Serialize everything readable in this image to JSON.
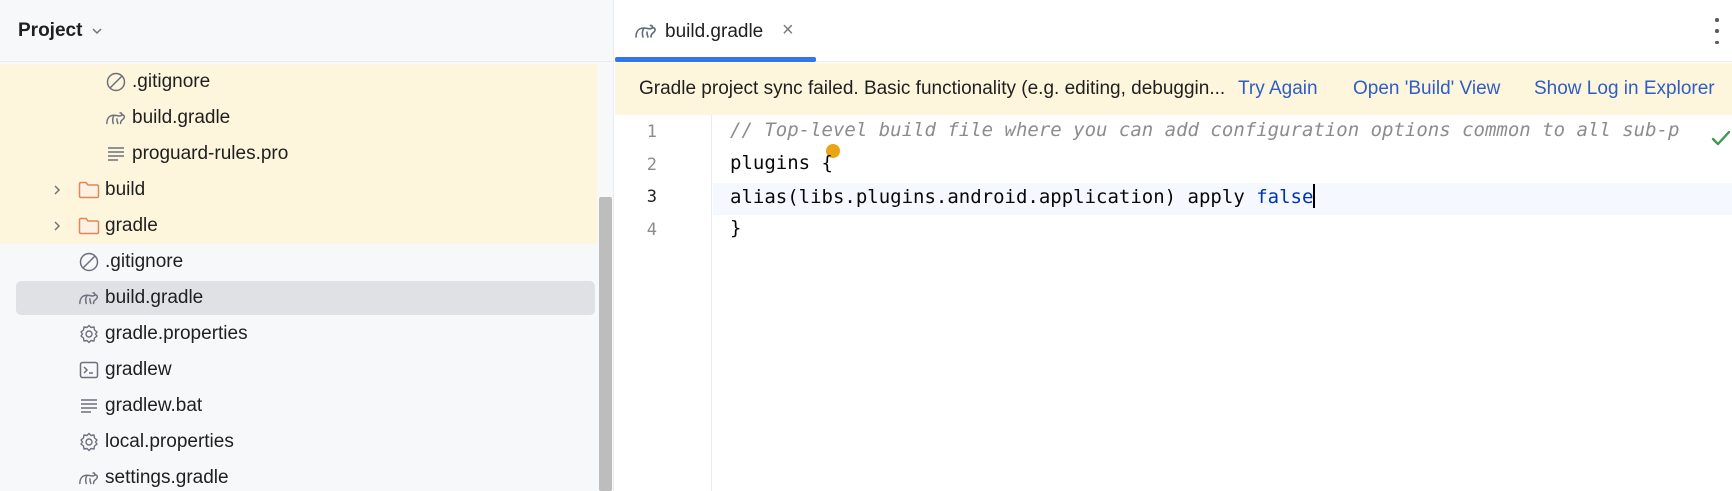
{
  "project_panel": {
    "title": "Project",
    "tree": [
      {
        "label": ".gitignore",
        "icon": "ignore-icon",
        "indent": 2,
        "arrow": false,
        "highlight": true,
        "selected": false
      },
      {
        "label": "build.gradle",
        "icon": "gradle-icon",
        "indent": 2,
        "arrow": false,
        "highlight": true,
        "selected": false
      },
      {
        "label": "proguard-rules.pro",
        "icon": "text-file-icon",
        "indent": 2,
        "arrow": false,
        "highlight": true,
        "selected": false
      },
      {
        "label": "build",
        "icon": "folder-icon",
        "indent": 1,
        "arrow": true,
        "highlight": true,
        "selected": false
      },
      {
        "label": "gradle",
        "icon": "folder-icon",
        "indent": 1,
        "arrow": true,
        "highlight": true,
        "selected": false
      },
      {
        "label": ".gitignore",
        "icon": "ignore-icon",
        "indent": 1,
        "arrow": false,
        "highlight": false,
        "selected": false
      },
      {
        "label": "build.gradle",
        "icon": "gradle-icon",
        "indent": 1,
        "arrow": false,
        "highlight": false,
        "selected": true
      },
      {
        "label": "gradle.properties",
        "icon": "settings-file-icon",
        "indent": 1,
        "arrow": false,
        "highlight": false,
        "selected": false
      },
      {
        "label": "gradlew",
        "icon": "terminal-file-icon",
        "indent": 1,
        "arrow": false,
        "highlight": false,
        "selected": false
      },
      {
        "label": "gradlew.bat",
        "icon": "text-file-icon",
        "indent": 1,
        "arrow": false,
        "highlight": false,
        "selected": false
      },
      {
        "label": "local.properties",
        "icon": "settings-file-icon",
        "indent": 1,
        "arrow": false,
        "highlight": false,
        "selected": false
      },
      {
        "label": "settings.gradle",
        "icon": "gradle-icon",
        "indent": 1,
        "arrow": false,
        "highlight": false,
        "selected": false
      }
    ]
  },
  "editor": {
    "tab": {
      "label": "build.gradle",
      "close": "×"
    },
    "banner": {
      "message": "Gradle project sync failed. Basic functionality (e.g. editing, debuggin...",
      "links": [
        "Try Again",
        "Open 'Build' View",
        "Show Log in Explorer"
      ]
    },
    "lines": [
      {
        "num": "1",
        "tokens": [
          {
            "t": "// Top-level build file where you can add configuration options common to all sub-p",
            "c": "comment"
          }
        ]
      },
      {
        "num": "2",
        "tokens": [
          {
            "t": "plugins {",
            "c": "plain"
          }
        ]
      },
      {
        "num": "3",
        "tokens": [
          {
            "t": "alias(libs.plugins.android.application) apply ",
            "c": "plain"
          },
          {
            "t": "false",
            "c": "kw"
          }
        ]
      },
      {
        "num": "4",
        "tokens": [
          {
            "t": "}",
            "c": "plain"
          }
        ]
      }
    ],
    "current_line": "3",
    "colors": {
      "accent": "#3574f0",
      "link": "#2f5ec4",
      "banner_bg": "#fdf5dc",
      "keyword": "#0033b3",
      "comment": "#8c8c8c",
      "warning": "#e9a514",
      "ok": "#3d9a50"
    }
  }
}
